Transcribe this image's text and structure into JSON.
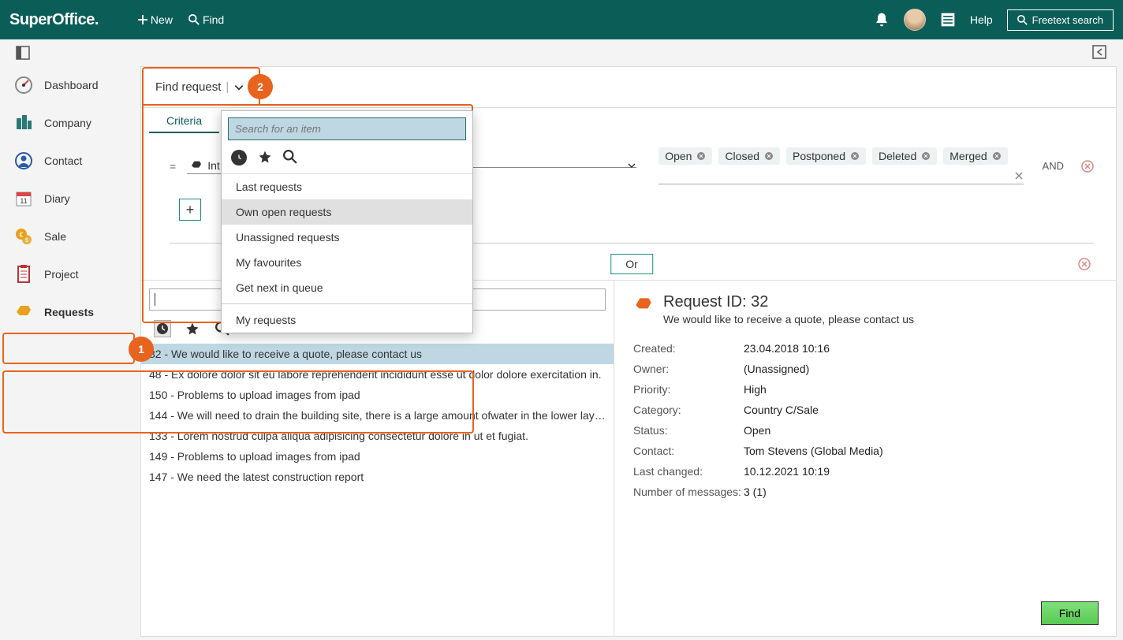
{
  "topbar": {
    "logo": "SuperOffice.",
    "new_label": "New",
    "find_label": "Find",
    "help_label": "Help",
    "freetext_label": "Freetext search"
  },
  "sidebar": {
    "items": [
      {
        "label": "Dashboard"
      },
      {
        "label": "Company"
      },
      {
        "label": "Contact"
      },
      {
        "label": "Diary"
      },
      {
        "label": "Sale"
      },
      {
        "label": "Project"
      },
      {
        "label": "Requests"
      }
    ]
  },
  "callouts": {
    "one": "1",
    "two": "2"
  },
  "find_header": {
    "title": "Find request"
  },
  "tabs": {
    "criteria": "Criteria"
  },
  "criteria": {
    "equals": "=",
    "field_partial": "Int",
    "chips": [
      "Open",
      "Closed",
      "Postponed",
      "Deleted",
      "Merged"
    ],
    "and_label": "AND",
    "plus": "+",
    "or_label": "Or"
  },
  "dropdown": {
    "search_placeholder": "Search for an item",
    "items_top": [
      "Last requests",
      "Own open requests",
      "Unassigned requests",
      "My favourites",
      "Get next in queue"
    ],
    "items_bottom": [
      "My requests"
    ]
  },
  "requests_list": [
    {
      "id": "32",
      "title": "We would like to receive a quote, please contact us"
    },
    {
      "id": "48",
      "title": "Ex dolore dolor sit eu labore reprehenderit incididunt esse ut dolor dolore exercitation in."
    },
    {
      "id": "150",
      "title": "Problems to upload images from ipad"
    },
    {
      "id": "144",
      "title": "We will need to drain the building site, there is a large amount ofwater in the lower layers"
    },
    {
      "id": "133",
      "title": "Lorem nostrud culpa aliqua adipisicing consectetur dolore in ut et fugiat."
    },
    {
      "id": "149",
      "title": "Problems to upload images from ipad"
    },
    {
      "id": "147",
      "title": "We need the latest construction report"
    }
  ],
  "request_detail": {
    "title_prefix": "Request ID: ",
    "id": "32",
    "subtitle": "We would like to receive a quote, please contact us",
    "rows": [
      {
        "label": "Created:",
        "value": "23.04.2018 10:16"
      },
      {
        "label": "Owner:",
        "value": "(Unassigned)"
      },
      {
        "label": "Priority:",
        "value": "High"
      },
      {
        "label": "Category:",
        "value": "Country C/Sale"
      },
      {
        "label": "Status:",
        "value": "Open"
      },
      {
        "label": "Contact:",
        "value": "Tom Stevens (Global Media)"
      },
      {
        "label": "Last changed:",
        "value": "10.12.2021 10:19"
      },
      {
        "label": "Number of messages:",
        "value": "3 (1)"
      }
    ]
  },
  "find_button": "Find"
}
